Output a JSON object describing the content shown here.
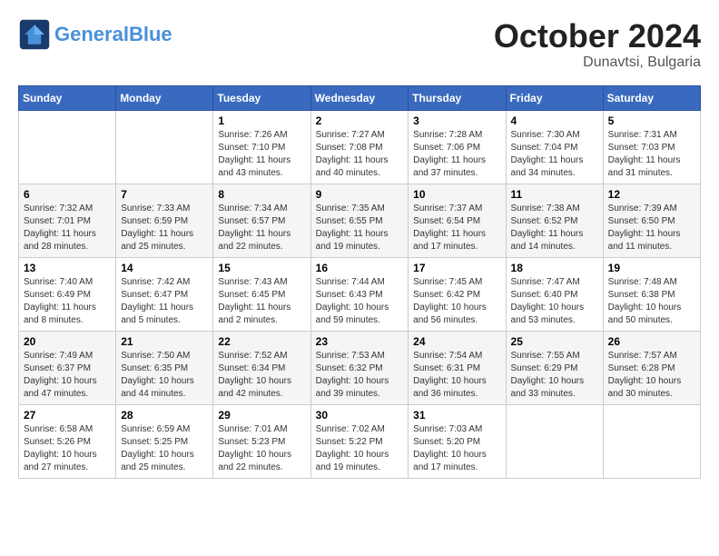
{
  "header": {
    "logo_general": "General",
    "logo_blue": "Blue",
    "month_title": "October 2024",
    "subtitle": "Dunavtsi, Bulgaria"
  },
  "calendar": {
    "days_of_week": [
      "Sunday",
      "Monday",
      "Tuesday",
      "Wednesday",
      "Thursday",
      "Friday",
      "Saturday"
    ],
    "weeks": [
      [
        {
          "day": "",
          "info": ""
        },
        {
          "day": "",
          "info": ""
        },
        {
          "day": "1",
          "info": "Sunrise: 7:26 AM\nSunset: 7:10 PM\nDaylight: 11 hours and 43 minutes."
        },
        {
          "day": "2",
          "info": "Sunrise: 7:27 AM\nSunset: 7:08 PM\nDaylight: 11 hours and 40 minutes."
        },
        {
          "day": "3",
          "info": "Sunrise: 7:28 AM\nSunset: 7:06 PM\nDaylight: 11 hours and 37 minutes."
        },
        {
          "day": "4",
          "info": "Sunrise: 7:30 AM\nSunset: 7:04 PM\nDaylight: 11 hours and 34 minutes."
        },
        {
          "day": "5",
          "info": "Sunrise: 7:31 AM\nSunset: 7:03 PM\nDaylight: 11 hours and 31 minutes."
        }
      ],
      [
        {
          "day": "6",
          "info": "Sunrise: 7:32 AM\nSunset: 7:01 PM\nDaylight: 11 hours and 28 minutes."
        },
        {
          "day": "7",
          "info": "Sunrise: 7:33 AM\nSunset: 6:59 PM\nDaylight: 11 hours and 25 minutes."
        },
        {
          "day": "8",
          "info": "Sunrise: 7:34 AM\nSunset: 6:57 PM\nDaylight: 11 hours and 22 minutes."
        },
        {
          "day": "9",
          "info": "Sunrise: 7:35 AM\nSunset: 6:55 PM\nDaylight: 11 hours and 19 minutes."
        },
        {
          "day": "10",
          "info": "Sunrise: 7:37 AM\nSunset: 6:54 PM\nDaylight: 11 hours and 17 minutes."
        },
        {
          "day": "11",
          "info": "Sunrise: 7:38 AM\nSunset: 6:52 PM\nDaylight: 11 hours and 14 minutes."
        },
        {
          "day": "12",
          "info": "Sunrise: 7:39 AM\nSunset: 6:50 PM\nDaylight: 11 hours and 11 minutes."
        }
      ],
      [
        {
          "day": "13",
          "info": "Sunrise: 7:40 AM\nSunset: 6:49 PM\nDaylight: 11 hours and 8 minutes."
        },
        {
          "day": "14",
          "info": "Sunrise: 7:42 AM\nSunset: 6:47 PM\nDaylight: 11 hours and 5 minutes."
        },
        {
          "day": "15",
          "info": "Sunrise: 7:43 AM\nSunset: 6:45 PM\nDaylight: 11 hours and 2 minutes."
        },
        {
          "day": "16",
          "info": "Sunrise: 7:44 AM\nSunset: 6:43 PM\nDaylight: 10 hours and 59 minutes."
        },
        {
          "day": "17",
          "info": "Sunrise: 7:45 AM\nSunset: 6:42 PM\nDaylight: 10 hours and 56 minutes."
        },
        {
          "day": "18",
          "info": "Sunrise: 7:47 AM\nSunset: 6:40 PM\nDaylight: 10 hours and 53 minutes."
        },
        {
          "day": "19",
          "info": "Sunrise: 7:48 AM\nSunset: 6:38 PM\nDaylight: 10 hours and 50 minutes."
        }
      ],
      [
        {
          "day": "20",
          "info": "Sunrise: 7:49 AM\nSunset: 6:37 PM\nDaylight: 10 hours and 47 minutes."
        },
        {
          "day": "21",
          "info": "Sunrise: 7:50 AM\nSunset: 6:35 PM\nDaylight: 10 hours and 44 minutes."
        },
        {
          "day": "22",
          "info": "Sunrise: 7:52 AM\nSunset: 6:34 PM\nDaylight: 10 hours and 42 minutes."
        },
        {
          "day": "23",
          "info": "Sunrise: 7:53 AM\nSunset: 6:32 PM\nDaylight: 10 hours and 39 minutes."
        },
        {
          "day": "24",
          "info": "Sunrise: 7:54 AM\nSunset: 6:31 PM\nDaylight: 10 hours and 36 minutes."
        },
        {
          "day": "25",
          "info": "Sunrise: 7:55 AM\nSunset: 6:29 PM\nDaylight: 10 hours and 33 minutes."
        },
        {
          "day": "26",
          "info": "Sunrise: 7:57 AM\nSunset: 6:28 PM\nDaylight: 10 hours and 30 minutes."
        }
      ],
      [
        {
          "day": "27",
          "info": "Sunrise: 6:58 AM\nSunset: 5:26 PM\nDaylight: 10 hours and 27 minutes."
        },
        {
          "day": "28",
          "info": "Sunrise: 6:59 AM\nSunset: 5:25 PM\nDaylight: 10 hours and 25 minutes."
        },
        {
          "day": "29",
          "info": "Sunrise: 7:01 AM\nSunset: 5:23 PM\nDaylight: 10 hours and 22 minutes."
        },
        {
          "day": "30",
          "info": "Sunrise: 7:02 AM\nSunset: 5:22 PM\nDaylight: 10 hours and 19 minutes."
        },
        {
          "day": "31",
          "info": "Sunrise: 7:03 AM\nSunset: 5:20 PM\nDaylight: 10 hours and 17 minutes."
        },
        {
          "day": "",
          "info": ""
        },
        {
          "day": "",
          "info": ""
        }
      ]
    ]
  }
}
